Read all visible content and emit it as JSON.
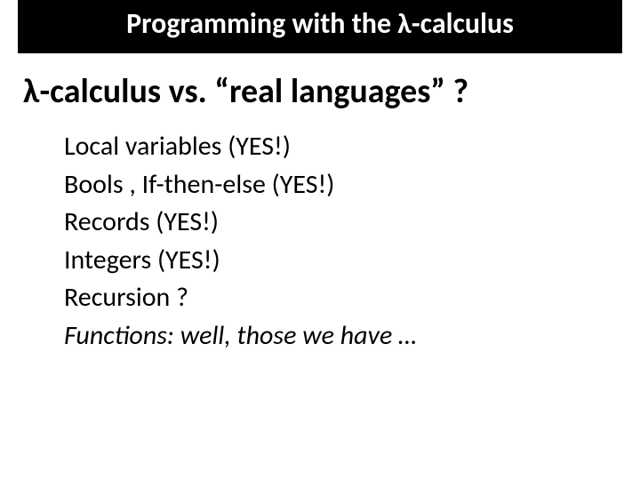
{
  "title": "Programming with the λ-calculus",
  "subheading": "λ-calculus vs. “real languages” ?",
  "items": [
    "Local variables (YES!)",
    "Bools , If-then-else (YES!)",
    "Records (YES!)",
    "Integers (YES!)",
    "Recursion ?",
    "Functions: well, those we have …"
  ]
}
